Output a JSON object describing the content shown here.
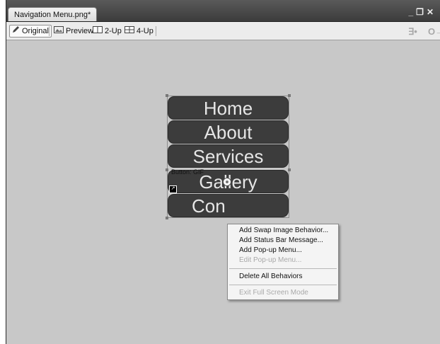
{
  "document_tab": {
    "title": "Navigation Menu.png*"
  },
  "window_controls": {
    "minimize": "_",
    "restore": "❐",
    "close": "✕"
  },
  "view_tabs": [
    {
      "label": "Original",
      "icon": "pencil-icon",
      "active": true
    },
    {
      "label": "Preview",
      "icon": "preview-icon",
      "active": false
    },
    {
      "label": "2-Up",
      "icon": "two-up-icon",
      "active": false
    },
    {
      "label": "4-Up",
      "icon": "four-up-icon",
      "active": false
    }
  ],
  "nav_buttons": [
    "Home",
    "About",
    "Services",
    "Gallery",
    "Con"
  ],
  "slice": {
    "label": "Button: GIF"
  },
  "context_menu": {
    "items": [
      {
        "label": "Add Swap Image Behavior...",
        "enabled": true
      },
      {
        "label": "Add Status Bar Message...",
        "enabled": true
      },
      {
        "label": "Add Pop-up Menu...",
        "enabled": true
      },
      {
        "label": "Edit Pop-up Menu...",
        "enabled": false
      },
      {
        "label": "Delete All Behaviors",
        "enabled": true
      },
      {
        "label": "Exit Full Screen Mode",
        "enabled": false
      }
    ]
  },
  "colors": {
    "canvas": "#c8c8c8",
    "button_fill": "#3c3c3c",
    "button_text": "#e6e6e6"
  }
}
